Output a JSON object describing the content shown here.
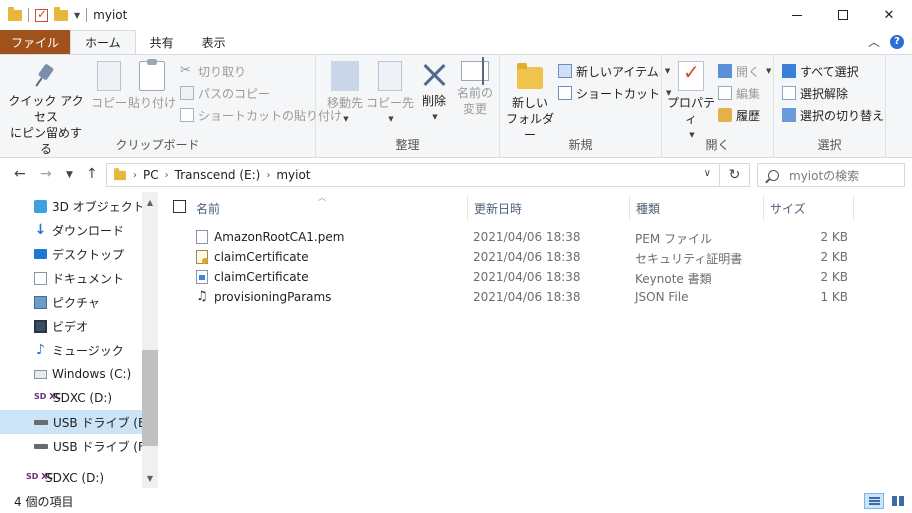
{
  "window": {
    "title": "myiot"
  },
  "tabs": {
    "file": "ファイル",
    "home": "ホーム",
    "share": "共有",
    "view": "表示"
  },
  "ribbon": {
    "clipboard": {
      "label": "クリップボード",
      "pin_line1": "クイック アクセス",
      "pin_line2": "にピン留めする",
      "copy": "コピー",
      "paste": "貼り付け",
      "cut": "切り取り",
      "copy_path": "パスのコピー",
      "paste_shortcut": "ショートカットの貼り付け"
    },
    "organize": {
      "label": "整理",
      "move_to": "移動先",
      "copy_to": "コピー先",
      "delete": "削除",
      "rename_line1": "名前の",
      "rename_line2": "変更"
    },
    "new": {
      "label": "新規",
      "new_folder_line1": "新しい",
      "new_folder_line2": "フォルダー",
      "new_item": "新しいアイテム",
      "shortcut": "ショートカット"
    },
    "open": {
      "label": "開く",
      "properties": "プロパティ",
      "open": "開く",
      "edit": "編集",
      "history": "履歴"
    },
    "select": {
      "label": "選択",
      "select_all": "すべて選択",
      "select_none": "選択解除",
      "invert": "選択の切り替え"
    }
  },
  "address": {
    "crumbs": [
      "PC",
      "Transcend (E:)",
      "myiot"
    ],
    "search_placeholder": "myiotの検索"
  },
  "nav": {
    "items": [
      {
        "label": "3D オブジェクト",
        "icon": "cube-icon"
      },
      {
        "label": "ダウンロード",
        "icon": "download-icon"
      },
      {
        "label": "デスクトップ",
        "icon": "desktop-icon"
      },
      {
        "label": "ドキュメント",
        "icon": "document-icon"
      },
      {
        "label": "ピクチャ",
        "icon": "picture-icon"
      },
      {
        "label": "ビデオ",
        "icon": "video-icon"
      },
      {
        "label": "ミュージック",
        "icon": "music-icon"
      },
      {
        "label": "Windows (C:)",
        "icon": "drive-icon"
      },
      {
        "label": "SDXC (D:)",
        "icon": "sd-card-icon"
      },
      {
        "label": "USB ドライブ (E:)",
        "icon": "usb-icon",
        "selected": true
      },
      {
        "label": "USB ドライブ (F:)",
        "icon": "usb-icon"
      },
      {
        "label": "SDXC (D:)",
        "icon": "sd-card-icon"
      }
    ]
  },
  "columns": {
    "name": "名前",
    "date": "更新日時",
    "type": "種類",
    "size": "サイズ"
  },
  "files": [
    {
      "name": "AmazonRootCA1.pem",
      "date": "2021/04/06 18:38",
      "type": "PEM ファイル",
      "size": "2 KB"
    },
    {
      "name": "claimCertificate",
      "date": "2021/04/06 18:38",
      "type": "セキュリティ証明書",
      "size": "2 KB"
    },
    {
      "name": "claimCertificate",
      "date": "2021/04/06 18:38",
      "type": "Keynote 書類",
      "size": "2 KB"
    },
    {
      "name": "provisioningParams",
      "date": "2021/04/06 18:38",
      "type": "JSON File",
      "size": "1 KB"
    }
  ],
  "status": {
    "item_count": "4 個の項目"
  },
  "colors": {
    "file_tab": "#a0521c",
    "selection": "#cce4f7",
    "accent": "#2b6fd6"
  }
}
